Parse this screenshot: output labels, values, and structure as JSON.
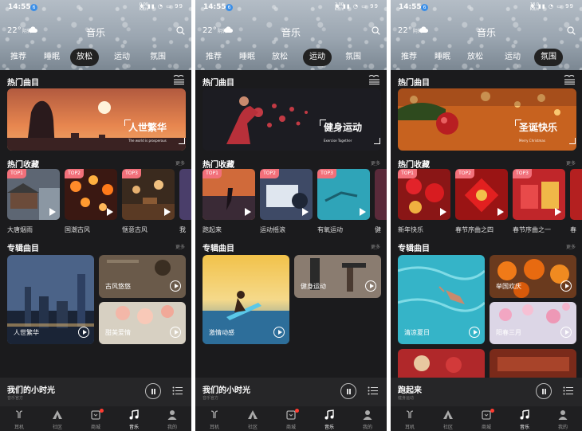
{
  "status": {
    "time": "14:55",
    "badge": "6",
    "icons": "✱ ▮▮ ◔ ▭",
    "speeds": [
      "0.00",
      "2.00",
      "18.0"
    ],
    "speed_unit": "KB/s",
    "battery": "99"
  },
  "weather": {
    "temp": "22°",
    "condition": "阴转"
  },
  "app_title": "音乐",
  "tabs": [
    "推荐",
    "睡眠",
    "放松",
    "运动",
    "氛围"
  ],
  "sections": {
    "hot_tracks": "热门曲目",
    "hot_favorites": "热门收藏",
    "albums": "专辑曲目",
    "more": "更多"
  },
  "panels": [
    {
      "active_tab": 2,
      "banner": {
        "title": "人世繁华",
        "subtitle": "The world is prosperous"
      },
      "favorites": [
        {
          "rank": "TOP1",
          "label": "大唐烟雨"
        },
        {
          "rank": "TOP2",
          "label": "国潮古风"
        },
        {
          "rank": "TOP3",
          "label": "惬意古风"
        },
        {
          "rank": "",
          "label": "我"
        }
      ],
      "albums": [
        "人世繁华",
        "古风悠悠",
        "甜美爱情"
      ],
      "now_playing": {
        "title": "我们的小时光",
        "artist": "音乐官方"
      }
    },
    {
      "active_tab": 3,
      "banner": {
        "title": "健身运动",
        "subtitle": "Exercise Together"
      },
      "favorites": [
        {
          "rank": "TOP1",
          "label": "跑起来"
        },
        {
          "rank": "TOP2",
          "label": "运动摇滚"
        },
        {
          "rank": "TOP3",
          "label": "有氧运动"
        },
        {
          "rank": "",
          "label": "健"
        }
      ],
      "albums": [
        "激情动感",
        "健身运动"
      ],
      "now_playing": {
        "title": "我们的小时光",
        "artist": "音乐官方"
      }
    },
    {
      "active_tab": 4,
      "banner": {
        "title": "圣诞快乐",
        "subtitle": "Merry Christmas"
      },
      "favorites": [
        {
          "rank": "TOP1",
          "label": "新年快乐"
        },
        {
          "rank": "TOP2",
          "label": "春节序曲之四"
        },
        {
          "rank": "TOP3",
          "label": "春节序曲之一"
        },
        {
          "rank": "",
          "label": "春"
        }
      ],
      "albums": [
        "清凉夏日",
        "举国欢庆",
        "阳春三月"
      ],
      "now_playing": {
        "title": "跑起来",
        "artist": "健身运动"
      }
    }
  ],
  "bottom_nav": [
    {
      "label": "耳机",
      "icon": "earbuds-icon"
    },
    {
      "label": "社区",
      "icon": "community-icon"
    },
    {
      "label": "商城",
      "icon": "store-icon"
    },
    {
      "label": "音乐",
      "icon": "music-note-icon"
    },
    {
      "label": "我的",
      "icon": "profile-icon"
    }
  ],
  "nav_active": 3,
  "colors": {
    "rank_badge": "#f2707a",
    "background": "#1b1b1d",
    "accent_red": "#ff3b30"
  }
}
